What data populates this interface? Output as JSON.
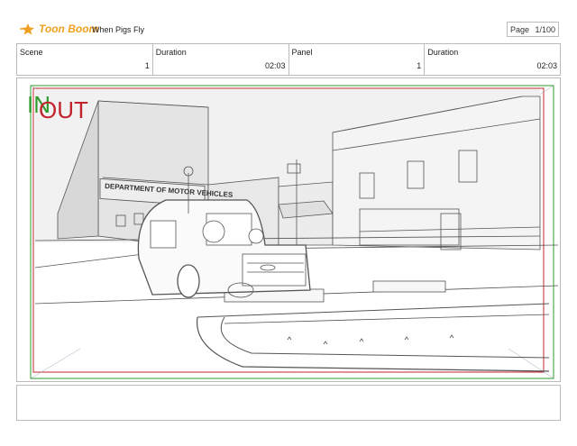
{
  "header": {
    "logo_text": "Toon Boom",
    "project_title": "When Pigs Fly",
    "page_label": "Page",
    "page_value": "1/100"
  },
  "info": {
    "scene_label": "Scene",
    "scene_value": "1",
    "duration1_label": "Duration",
    "duration1_value": "02:03",
    "panel_label": "Panel",
    "panel_value": "1",
    "duration2_label": "Duration",
    "duration2_value": "02:03"
  },
  "panel": {
    "in_label": "IN",
    "out_label": "OUT",
    "building_sign": "DEPARTMENT OF MOTOR VEHICLES",
    "in_color": "#2c9a2c",
    "out_color": "#c0242c"
  },
  "colors": {
    "logo": "#f0a020",
    "border": "#bbbbbb"
  }
}
